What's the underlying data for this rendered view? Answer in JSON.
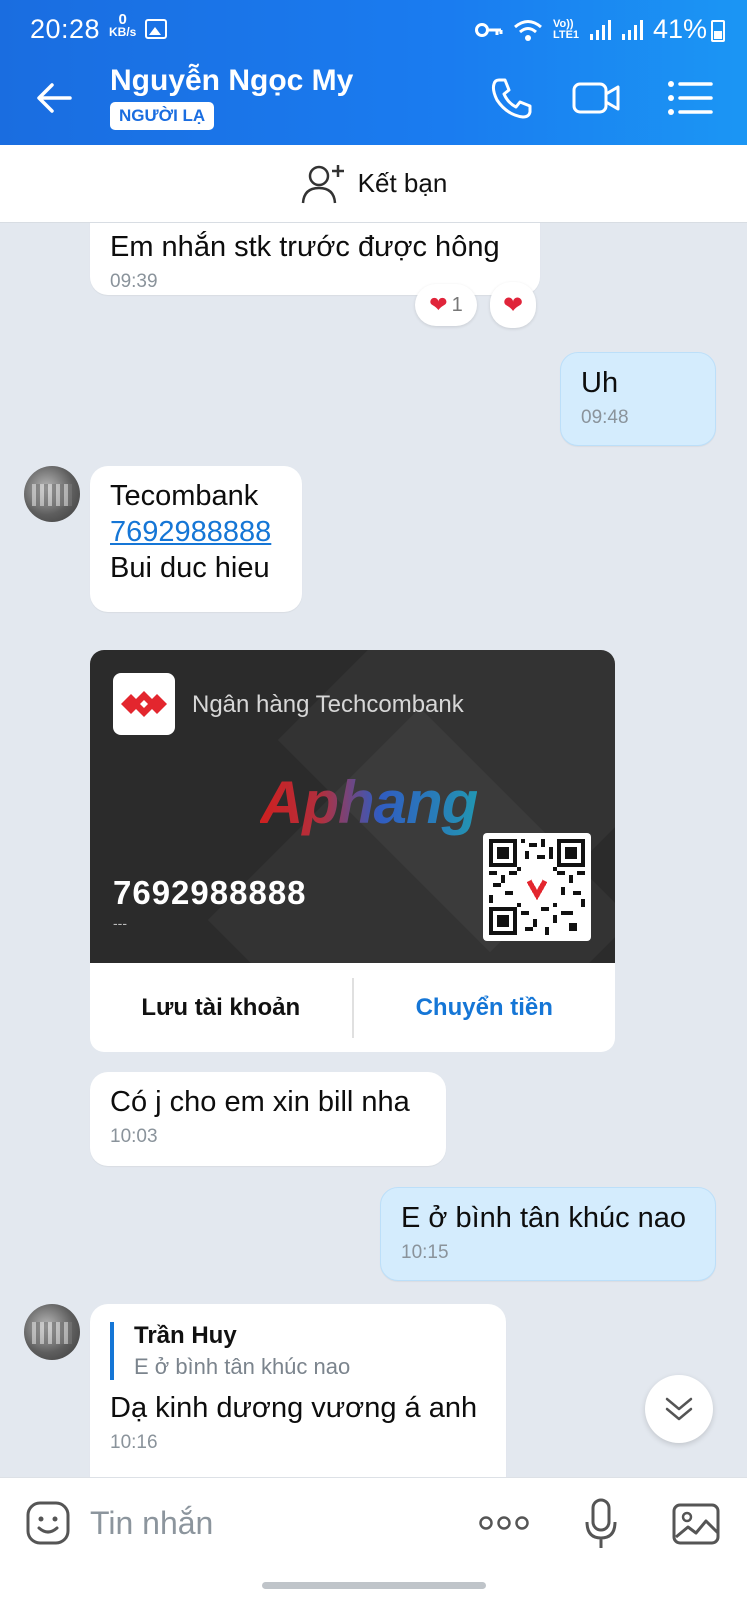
{
  "status_bar": {
    "time": "20:28",
    "net_speed_value": "0",
    "net_speed_unit": "KB/s",
    "battery_percent": "41%",
    "volte_label": "Vo)) LTE1"
  },
  "header": {
    "contact_name": "Nguyễn Ngọc My",
    "badge": "NGƯỜI LẠ"
  },
  "add_friend": {
    "label": "Kết bạn"
  },
  "messages": [
    {
      "text": "Em nhắn stk trước được hông",
      "time": "09:39"
    },
    {
      "text": "Uh",
      "time": "09:48"
    },
    {
      "line1": "Tecombank",
      "link": "7692988888",
      "line3": "Bui duc hieu"
    },
    {
      "text": "Có j cho em xin bill nha",
      "time": "10:03"
    },
    {
      "text": "E ở bình tân khúc nao",
      "time": "10:15"
    },
    {
      "reply_name": "Trần Huy",
      "reply_text": "E ở bình tân khúc nao",
      "text": "Dạ kinh dương vương á anh",
      "time": "10:16"
    }
  ],
  "reactions": {
    "count": "1"
  },
  "bank_card": {
    "bank_name": "Ngân hàng Techcombank",
    "watermark": "Aphang",
    "account_number": "7692988888",
    "holder": "---",
    "save_label": "Lưu tài khoản",
    "transfer_label": "Chuyển tiền",
    "brand_red": "#e3262e"
  },
  "composer": {
    "placeholder": "Tin nhắn"
  },
  "colors": {
    "header_blue": "#1a6de0",
    "my_bubble": "#d4ecfd",
    "link_blue": "#1576d6"
  }
}
